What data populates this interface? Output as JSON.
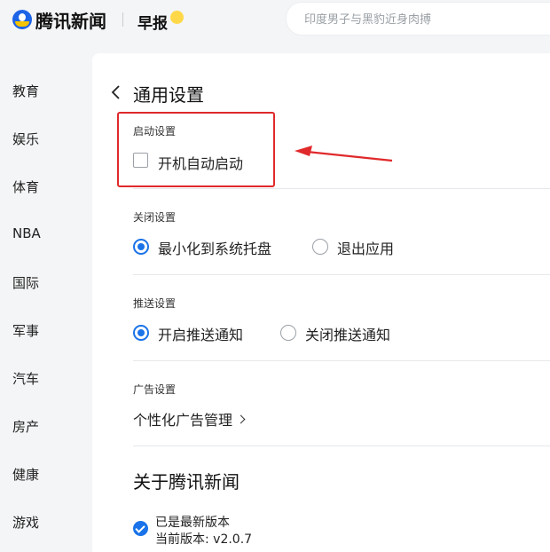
{
  "header": {
    "logo_text": "腾讯新闻",
    "zaobao_label": "早报",
    "search_placeholder": "印度男子与黑豹近身肉搏"
  },
  "sidebar": {
    "items": [
      "教育",
      "娱乐",
      "体育",
      "NBA",
      "国际",
      "军事",
      "汽车",
      "房产",
      "健康",
      "游戏"
    ]
  },
  "settings": {
    "title": "通用设置",
    "startup": {
      "label": "启动设置",
      "option": "开机自动启动",
      "checked": false
    },
    "close": {
      "label": "关闭设置",
      "options": [
        "最小化到系统托盘",
        "退出应用"
      ],
      "selected": "最小化到系统托盘"
    },
    "push": {
      "label": "推送设置",
      "options": [
        "开启推送通知",
        "关闭推送通知"
      ],
      "selected": "开启推送通知"
    },
    "ads": {
      "label": "广告设置",
      "link": "个性化广告管理"
    },
    "about": {
      "title": "关于腾讯新闻",
      "status": "已是最新版本",
      "current_version": "当前版本: v2.0.7"
    }
  },
  "colors": {
    "accent": "#1a73e8",
    "highlight_red": "#e0292b",
    "panel_bg": "#ffffff",
    "page_bg": "#f4f5f7"
  },
  "icons": [
    "logo-icon",
    "back-arrow-icon",
    "chevron-right-icon",
    "check-circle-icon",
    "annotation-arrow-icon"
  ]
}
